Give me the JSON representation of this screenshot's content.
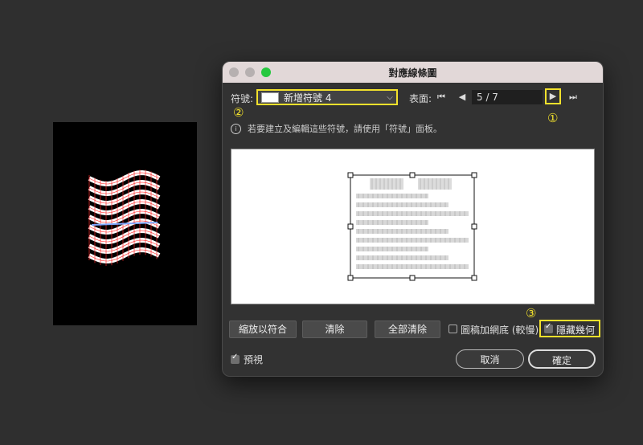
{
  "dialog": {
    "title": "對應線條圖",
    "symbol_label": "符號:",
    "symbol_value": "新增符號 4",
    "surface_label": "表面:",
    "surface_value": "5 / 7",
    "info_text": "若要建立及編輯這些符號，請使用「符號」面板。",
    "buttons": {
      "fit": "縮放以符合",
      "clear": "清除",
      "clear_all": "全部清除",
      "cancel": "取消",
      "ok": "確定"
    },
    "checkboxes": {
      "shade_artwork": "圖稿加網底 (較慢)",
      "shade_artwork_checked": false,
      "hide_geometry": "隱藏幾何",
      "hide_geometry_checked": true,
      "preview": "預視",
      "preview_checked": true
    }
  },
  "callouts": [
    "①",
    "②",
    "③"
  ],
  "icons": {
    "first": "skip-to-first-icon",
    "prev": "previous-icon",
    "next": "next-icon",
    "last": "skip-to-last-icon",
    "info": "info-icon",
    "dropdown": "chevron-down-icon"
  },
  "colors": {
    "highlight": "#f2e12c",
    "wireframe": "#ff2a2a",
    "dialog_bg": "#323232",
    "titlebar": "#e2d8d8"
  }
}
